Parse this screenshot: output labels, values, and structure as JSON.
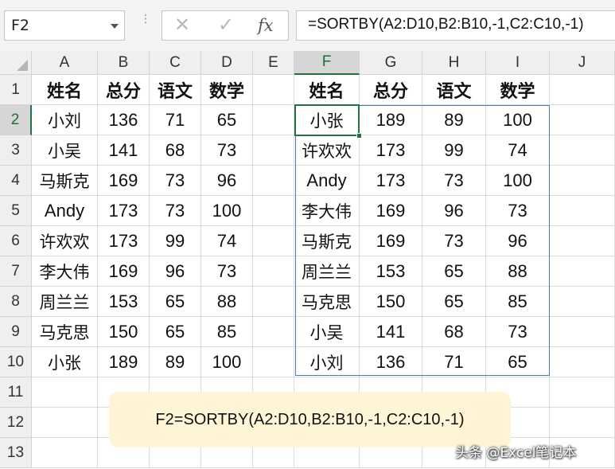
{
  "formula_bar": {
    "name_box": "F2",
    "cancel_icon": "x-icon",
    "enter_icon": "checkmark-icon",
    "function_icon": "fx-icon",
    "fx_label": "fx",
    "formula": "=SORTBY(A2:D10,B2:B10,-1,C2:C10,-1)"
  },
  "columns": [
    "A",
    "B",
    "C",
    "D",
    "E",
    "F",
    "G",
    "H",
    "I",
    "J"
  ],
  "rows": [
    "1",
    "2",
    "3",
    "4",
    "5",
    "6",
    "7",
    "8",
    "9",
    "10",
    "11",
    "12",
    "13"
  ],
  "selected": {
    "column": "F",
    "row": "2"
  },
  "source_table": {
    "headers": [
      "姓名",
      "总分",
      "语文",
      "数学"
    ],
    "rows": [
      [
        "小刘",
        "136",
        "71",
        "65"
      ],
      [
        "小吴",
        "141",
        "68",
        "73"
      ],
      [
        "马斯克",
        "169",
        "73",
        "96"
      ],
      [
        "Andy",
        "173",
        "73",
        "100"
      ],
      [
        "许欢欢",
        "173",
        "99",
        "74"
      ],
      [
        "李大伟",
        "169",
        "96",
        "73"
      ],
      [
        "周兰兰",
        "153",
        "65",
        "88"
      ],
      [
        "马克思",
        "150",
        "65",
        "85"
      ],
      [
        "小张",
        "189",
        "89",
        "100"
      ]
    ]
  },
  "result_table": {
    "headers": [
      "姓名",
      "总分",
      "语文",
      "数学"
    ],
    "rows": [
      [
        "小张",
        "189",
        "89",
        "100"
      ],
      [
        "许欢欢",
        "173",
        "99",
        "74"
      ],
      [
        "Andy",
        "173",
        "73",
        "100"
      ],
      [
        "李大伟",
        "169",
        "96",
        "73"
      ],
      [
        "马斯克",
        "169",
        "73",
        "96"
      ],
      [
        "周兰兰",
        "153",
        "65",
        "88"
      ],
      [
        "马克思",
        "150",
        "65",
        "85"
      ],
      [
        "小吴",
        "141",
        "68",
        "73"
      ],
      [
        "小刘",
        "136",
        "71",
        "65"
      ]
    ]
  },
  "note": "F2=SORTBY(A2:D10,B2:B10,-1,C2:C10,-1)",
  "watermark": "头条 @Excel笔记本",
  "colors": {
    "selection": "#217346",
    "spill_border": "#4a79c6",
    "note_bg": "#fff4d6"
  }
}
